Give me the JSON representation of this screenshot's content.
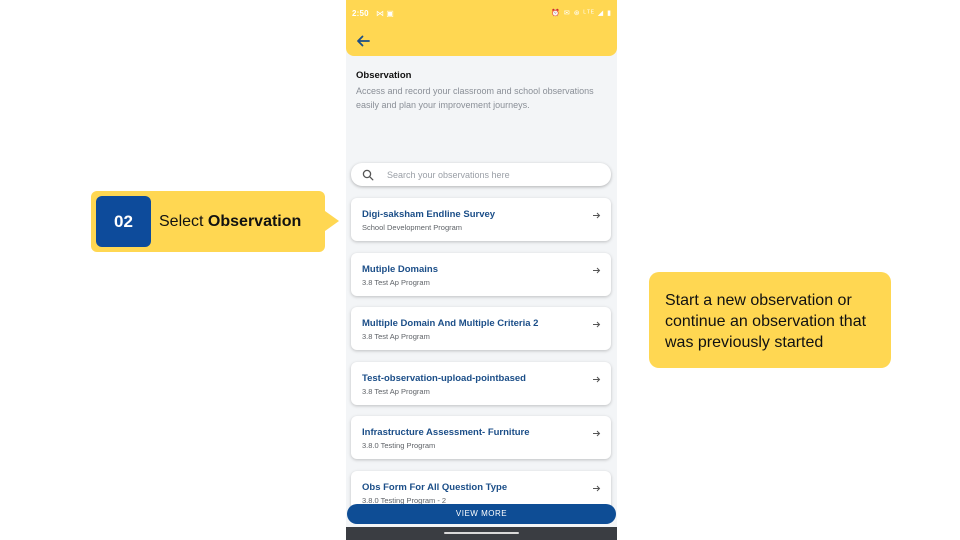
{
  "status_bar": {
    "time": "2:50",
    "left_icons": "⋈ ▣",
    "right_icons": "⏰ ✉ ⊛ ᴸᵀᴱ ◢ ▮"
  },
  "header": {
    "back_icon": "arrow-left-icon",
    "title": "Observation",
    "description": "Access and record your classroom and school observations easily and plan your improvement journeys."
  },
  "search": {
    "placeholder": "Search your observations here",
    "value": ""
  },
  "observations": [
    {
      "title": "Digi-saksham Endline Survey",
      "program": "School Development Program"
    },
    {
      "title": "Mutiple Domains",
      "program": "3.8 Test Ap Program"
    },
    {
      "title": "Multiple Domain And Multiple Criteria 2",
      "program": "3.8 Test Ap Program"
    },
    {
      "title": "Test-observation-upload-pointbased",
      "program": "3.8 Test Ap Program"
    },
    {
      "title": "Infrastructure Assessment- Furniture",
      "program": "3.8.0 Testing Program"
    },
    {
      "title": "Obs Form For All Question Type",
      "program": "3.8.0 Testing Program - 2"
    }
  ],
  "view_more_label": "VIEW MORE",
  "step_callout": {
    "number": "02",
    "prefix": "Select ",
    "emphasis": "Observation"
  },
  "info_callout": {
    "text": "Start a new observation or continue an observation that was previously started"
  },
  "colors": {
    "accent_yellow": "#ffd752",
    "primary_blue": "#0d4b9b",
    "card_title_blue": "#1b4e88",
    "nav_bar": "#3a3d42"
  }
}
